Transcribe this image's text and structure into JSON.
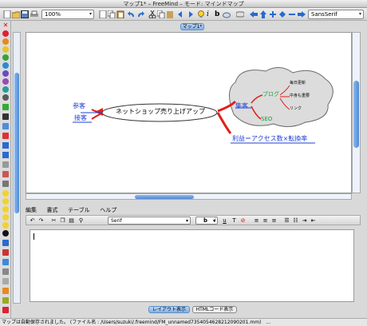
{
  "window": {
    "title": "マップ1* – FreeMind – モード: マインドマップ"
  },
  "toolbar": {
    "zoom_value": "100%",
    "font_value": "SansSerif"
  },
  "map_tab": {
    "label": "マップ1*"
  },
  "mindmap": {
    "root": "ネットショップ売り上げアップ",
    "left_nodes": [
      "参客",
      "接客"
    ],
    "cloud_node": "集客",
    "blog_node": "ブログ",
    "seo_node": "SEO",
    "blog_children": [
      "毎日更新",
      "中身も重要",
      "リンク"
    ],
    "profit_node": "利益＝アクセス数×転換率"
  },
  "editor_menu": {
    "items": [
      "編集",
      "書式",
      "テーブル",
      "ヘルプ"
    ]
  },
  "format_bar": {
    "font_value": "Serif",
    "size_value": ""
  },
  "bottom_tabs": {
    "layout": "レイアウト表示",
    "html": "HTMLコード表示"
  },
  "status": {
    "text": "マップは自動保存されました。 (ファイル名 : /Users/suzuki/.freemind/FM_unnamed7354054628212090201.mm)　..."
  },
  "colors": {
    "link_blue": "#1f3fd6",
    "branch_red": "#e0201b",
    "seo_green": "#1a9b3a",
    "accent_blue": "#4d8ad8"
  }
}
